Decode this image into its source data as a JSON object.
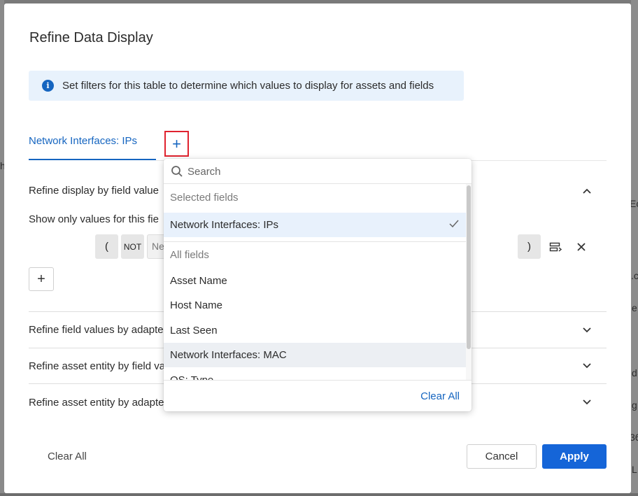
{
  "background": {
    "fragments": [
      "h",
      "Ec",
      ".c",
      "e",
      "d",
      "g",
      "36",
      "L"
    ]
  },
  "modal": {
    "title": "Refine Data Display",
    "info": {
      "icon": "info-icon",
      "text": "Set filters for this table to determine which values to display for assets and fields"
    },
    "tabs": [
      {
        "label": "Network Interfaces: IPs",
        "active": true
      }
    ],
    "add_field_label": "+",
    "sections": {
      "by_field_value": {
        "title": "Refine display by field value",
        "expanded": true,
        "show_only_text": "Show only values for this fie",
        "condition": {
          "open_paren": "(",
          "not_label": "NOT",
          "field_text": "Ne",
          "close_paren": ")"
        },
        "add_condition_label": "+"
      },
      "by_adapter": {
        "title": "Refine field values by adapte"
      },
      "entity_by_field": {
        "title": "Refine asset entity by field va"
      },
      "entity_by_adapter": {
        "title": "Refine asset entity by adapte"
      }
    },
    "footer": {
      "clear_all": "Clear All",
      "cancel": "Cancel",
      "apply": "Apply"
    }
  },
  "dropdown": {
    "search_placeholder": "Search",
    "selected_group": "Selected fields",
    "selected_items": [
      "Network Interfaces: IPs"
    ],
    "all_group": "All fields",
    "all_items": [
      "Asset Name",
      "Host Name",
      "Last Seen",
      "Network Interfaces: MAC",
      "OS: Type"
    ],
    "hovered_item": "Network Interfaces: MAC",
    "clear_all": "Clear All"
  },
  "colors": {
    "accent": "#1565c0",
    "apply_bg": "#1565d8",
    "highlight_border": "#e0222e",
    "info_bg": "#e8f2fc"
  }
}
